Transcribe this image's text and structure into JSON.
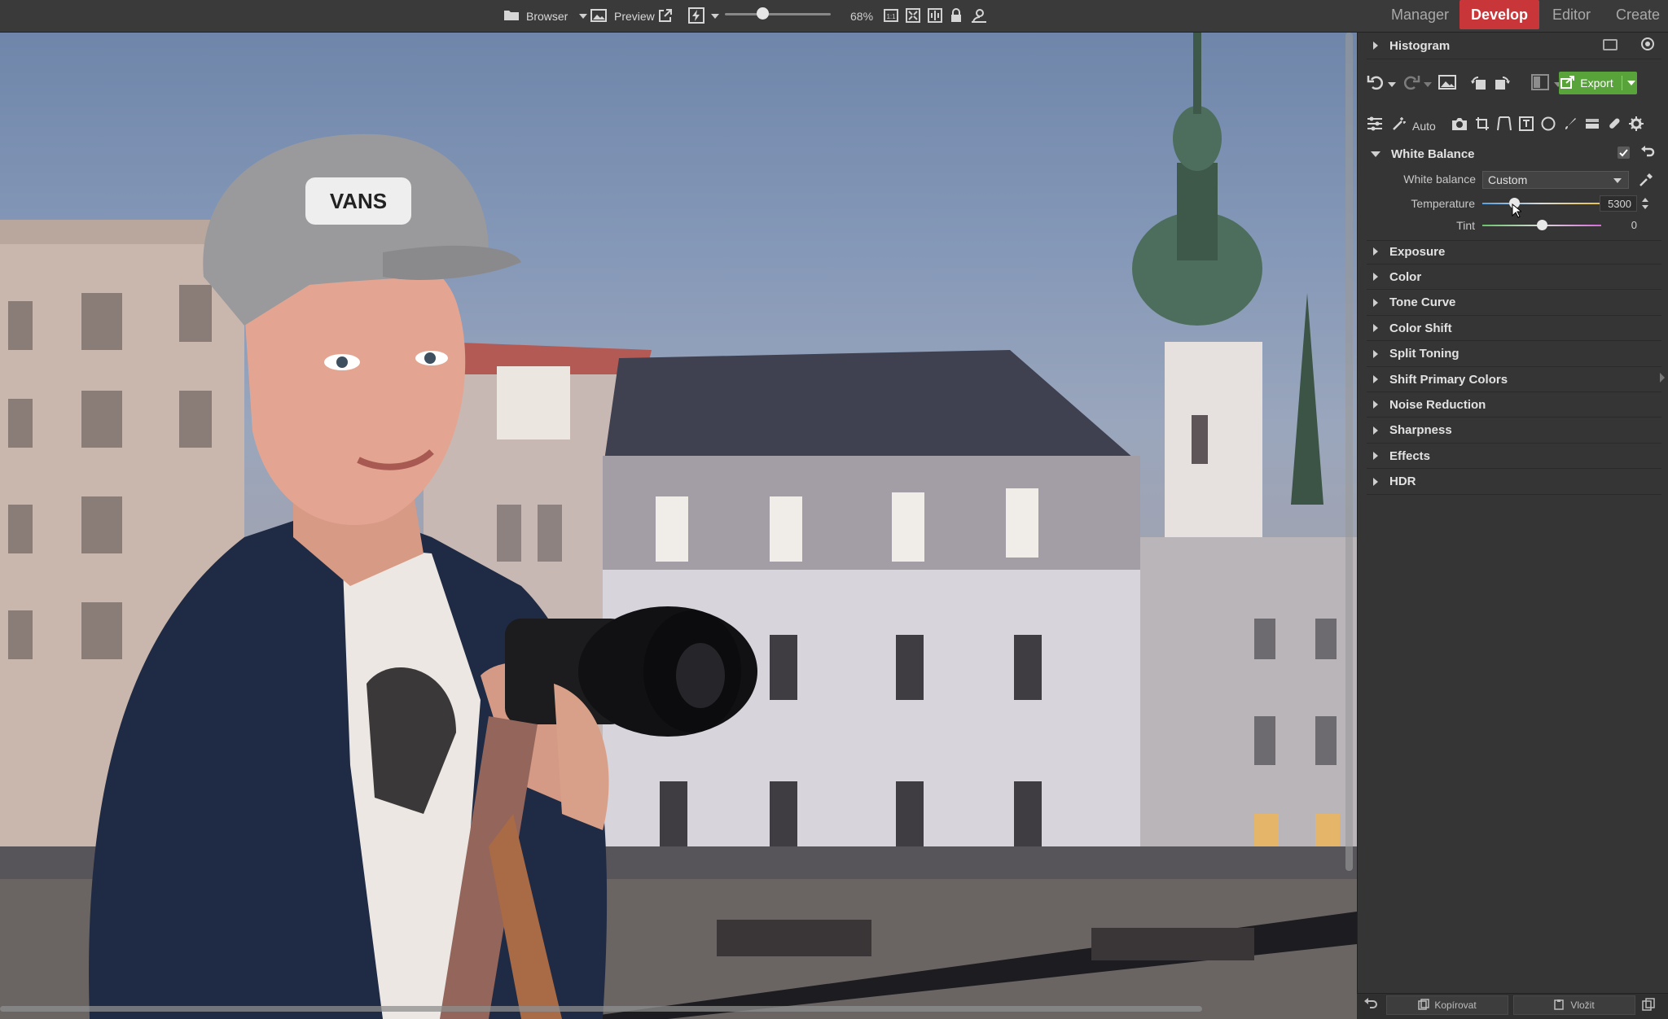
{
  "toolbar": {
    "browser_label": "Browser",
    "preview_label": "Preview",
    "zoom_level": "68%",
    "icons": [
      "folder-icon",
      "picture-icon",
      "external-window-icon",
      "flash-icon",
      "fit-1to1-icon",
      "fit-screen-icon",
      "fit-width-icon",
      "lock-icon",
      "person-search-icon"
    ]
  },
  "modules": {
    "manager": "Manager",
    "develop": "Develop",
    "editor": "Editor",
    "create": "Create",
    "active": "Develop",
    "active_color": "#c8363a"
  },
  "panel": {
    "histogram_title": "Histogram",
    "export_label": "Export",
    "export_color": "#58a33a",
    "auto_label": "Auto",
    "white_balance": {
      "title": "White Balance",
      "wb_label": "White balance",
      "wb_value": "Custom",
      "temperature_label": "Temperature",
      "temperature_value": "5300",
      "temperature_level": 0.27,
      "tint_label": "Tint",
      "tint_value": "0",
      "tint_level": 0.5
    },
    "sections": [
      "Exposure",
      "Color",
      "Tone Curve",
      "Color Shift",
      "Split Toning",
      "Shift Primary Colors",
      "Noise Reduction",
      "Sharpness",
      "Effects",
      "HDR"
    ],
    "bottom": {
      "copy_label": "Kopírovat",
      "paste_label": "Vložit"
    }
  }
}
